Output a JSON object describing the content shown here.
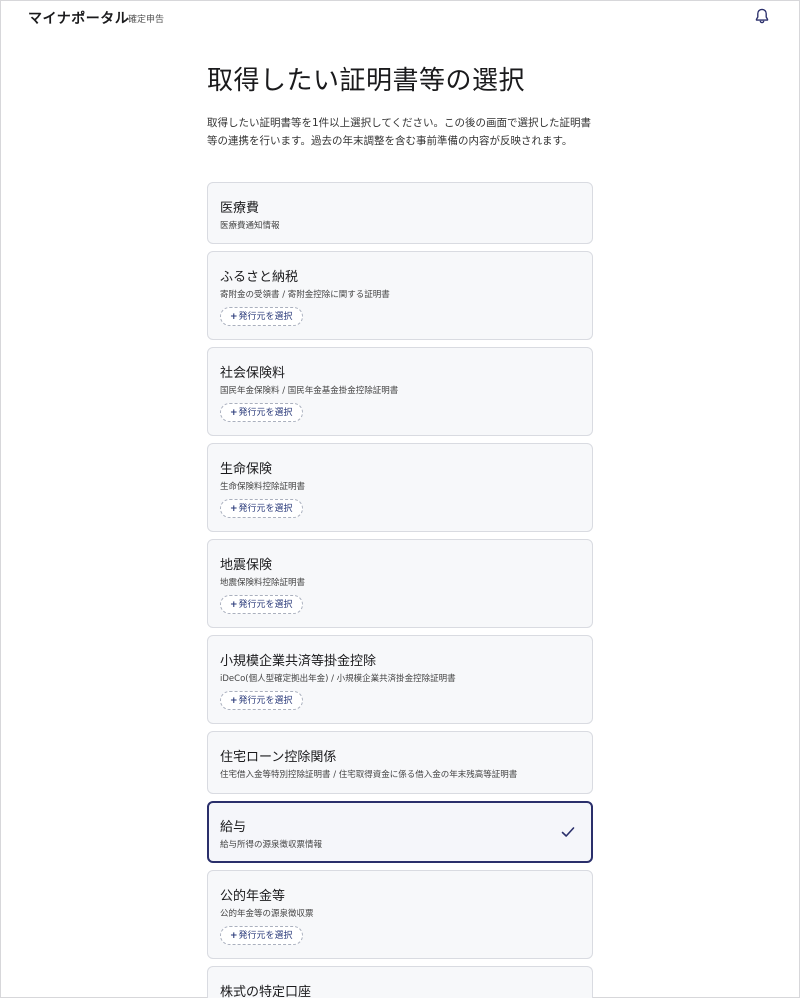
{
  "header": {
    "brand": "マイナポータル",
    "sub": "確定申告",
    "bell_icon": "bell-icon"
  },
  "page": {
    "title": "取得したい証明書等の選択",
    "description": "取得したい証明書等を1件以上選択してください。この後の画面で選択した証明書等の連携を行います。過去の年末調整を含む事前準備の内容が反映されます。"
  },
  "issuer_label": "発行元を選択",
  "accent_color": "#2a2f6b",
  "items": [
    {
      "title": "医療費",
      "subtitle": "医療費通知情報"
    },
    {
      "title": "ふるさと納税",
      "subtitle": "寄附金の受領書 / 寄附金控除に関する証明書"
    },
    {
      "title": "社会保険料",
      "subtitle": "国民年金保険料 / 国民年金基金掛金控除証明書"
    },
    {
      "title": "生命保険",
      "subtitle": "生命保険料控除証明書"
    },
    {
      "title": "地震保険",
      "subtitle": "地震保険料控除証明書"
    },
    {
      "title": "小規模企業共済等掛金控除",
      "subtitle": "iDeCo(個人型確定拠出年金) / 小規模企業共済掛金控除証明書"
    },
    {
      "title": "住宅ローン控除関係",
      "subtitle": "住宅借入金等特別控除証明書 / 住宅取得資金に係る借入金の年末残高等証明書"
    },
    {
      "title": "給与",
      "subtitle": "給与所得の源泉徴収票情報",
      "selected": true
    },
    {
      "title": "公的年金等",
      "subtitle": "公的年金等の源泉徴収票"
    },
    {
      "title": "株式の特定口座",
      "subtitle": ""
    }
  ]
}
